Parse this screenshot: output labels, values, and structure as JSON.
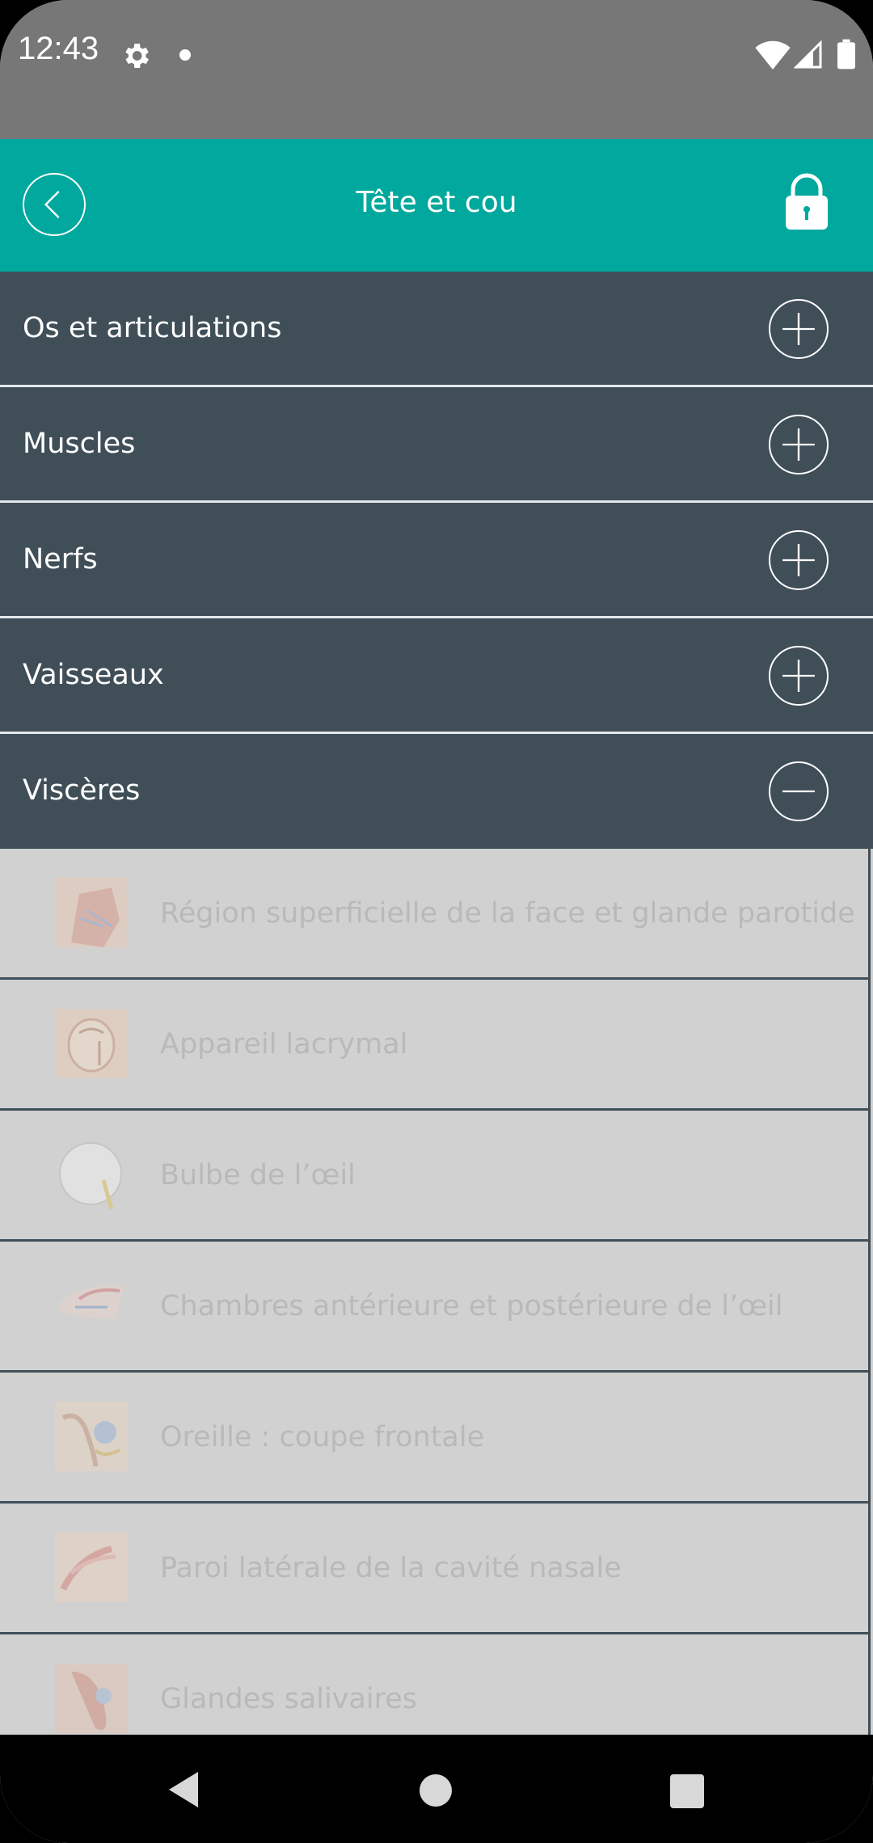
{
  "status_bar": {
    "time": "12:43",
    "icons": [
      "gear-icon",
      "dot-icon",
      "wifi-icon",
      "signal-icon",
      "battery-icon"
    ]
  },
  "header": {
    "title": "Tête et cou",
    "back_icon": "chevron-left-icon",
    "lock_icon": "lock-icon",
    "background": "#00a89d"
  },
  "categories": [
    {
      "label": "Os et articulations",
      "state": "collapsed"
    },
    {
      "label": "Muscles",
      "state": "collapsed"
    },
    {
      "label": "Nerfs",
      "state": "collapsed"
    },
    {
      "label": "Vaisseaux",
      "state": "collapsed"
    },
    {
      "label": "Viscères",
      "state": "expanded"
    }
  ],
  "visceres_items": [
    {
      "label": "Région superficielle de la face et glande parotide"
    },
    {
      "label": "Appareil lacrymal"
    },
    {
      "label": "Bulbe de l’œil"
    },
    {
      "label": "Chambres antérieure et postérieure de l’œil"
    },
    {
      "label": "Oreille : coupe frontale"
    },
    {
      "label": "Paroi latérale de la cavité nasale"
    },
    {
      "label": "Glandes salivaires"
    }
  ],
  "colors": {
    "category_bg": "#404e58",
    "list_bg": "#d1d1d1",
    "list_text": "#b9b9b9"
  }
}
